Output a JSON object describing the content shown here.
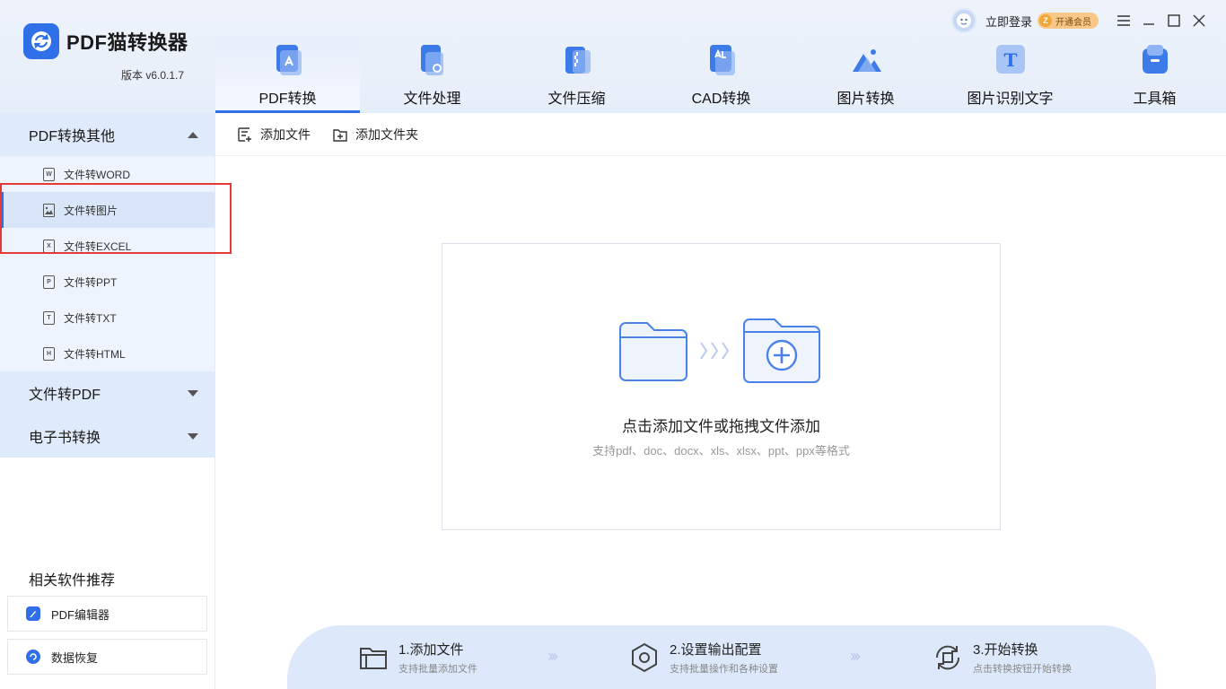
{
  "app": {
    "title": "PDF猫转换器",
    "version": "版本 v6.0.1.7",
    "colors": {
      "accent": "#2f6fe8",
      "vip": "#f7c887",
      "highlight": "#e53935"
    }
  },
  "user": {
    "login_label": "立即登录",
    "vip_label": "开通会员",
    "vip_badge": "Z"
  },
  "nav": {
    "items": [
      {
        "label": "PDF转换",
        "icon": "pdf-convert-icon",
        "active": true
      },
      {
        "label": "文件处理",
        "icon": "file-process-icon"
      },
      {
        "label": "文件压缩",
        "icon": "file-compress-icon"
      },
      {
        "label": "CAD转换",
        "icon": "cad-convert-icon"
      },
      {
        "label": "图片转换",
        "icon": "image-convert-icon"
      },
      {
        "label": "图片识别文字",
        "icon": "ocr-icon",
        "glyph": "T"
      },
      {
        "label": "工具箱",
        "icon": "toolbox-icon"
      }
    ]
  },
  "sidebar": {
    "group1": {
      "label": "PDF转换其他",
      "items": [
        {
          "label": "文件转WORD",
          "glyph": "W"
        },
        {
          "label": "文件转图片",
          "glyph": "",
          "active": true
        },
        {
          "label": "文件转EXCEL",
          "glyph": "X"
        },
        {
          "label": "文件转PPT",
          "glyph": "P"
        },
        {
          "label": "文件转TXT",
          "glyph": "T"
        },
        {
          "label": "文件转HTML",
          "glyph": "H"
        }
      ]
    },
    "group2": {
      "label": "文件转PDF"
    },
    "group3": {
      "label": "电子书转换"
    },
    "recommend": {
      "title": "相关软件推荐",
      "items": [
        {
          "label": "PDF编辑器"
        },
        {
          "label": "数据恢复"
        }
      ]
    }
  },
  "toolbar": {
    "add_file": "添加文件",
    "add_folder": "添加文件夹"
  },
  "dropzone": {
    "title": "点击添加文件或拖拽文件添加",
    "subtitle": "支持pdf、doc、docx、xls、xlsx、ppt、ppx等格式"
  },
  "steps": [
    {
      "title": "1.添加文件",
      "desc": "支持批量添加文件"
    },
    {
      "title": "2.设置输出配置",
      "desc": "支持批量操作和各种设置"
    },
    {
      "title": "3.开始转换",
      "desc": "点击转换按钮开始转换"
    }
  ],
  "steps_separator": "›››"
}
